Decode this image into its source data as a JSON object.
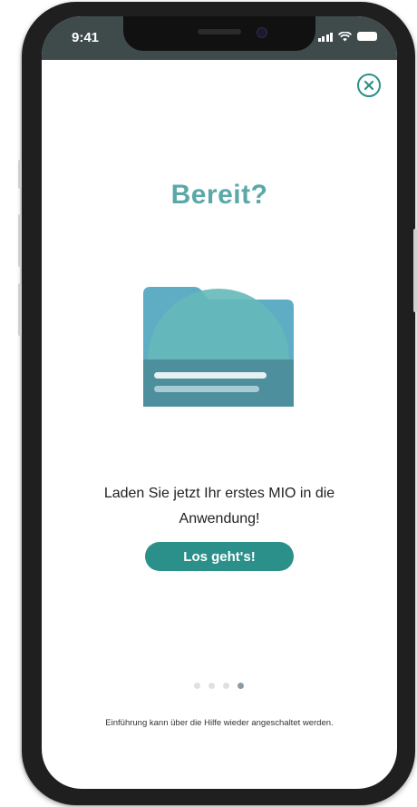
{
  "status_bar": {
    "time": "9:41"
  },
  "close_button": {
    "glyph": "×",
    "icon": "close-icon"
  },
  "onboarding": {
    "title": "Bereit?",
    "illustration_icon": "folder-icon",
    "message": "Laden Sie jetzt Ihr erstes MIO in die Anwendung!",
    "cta_label": "Los geht's!",
    "page_count": 4,
    "active_page": 4,
    "footer_note": "Einführung kann über die Hilfe wieder angeschaltet werden."
  },
  "colors": {
    "accent": "#2b8f8a",
    "title": "#5aa9a8",
    "status_bar": "#3f4b4b",
    "folder_back": "#5a9ed6",
    "folder_front": "#65b8b8",
    "folder_bottom": "#4e8f9e"
  }
}
